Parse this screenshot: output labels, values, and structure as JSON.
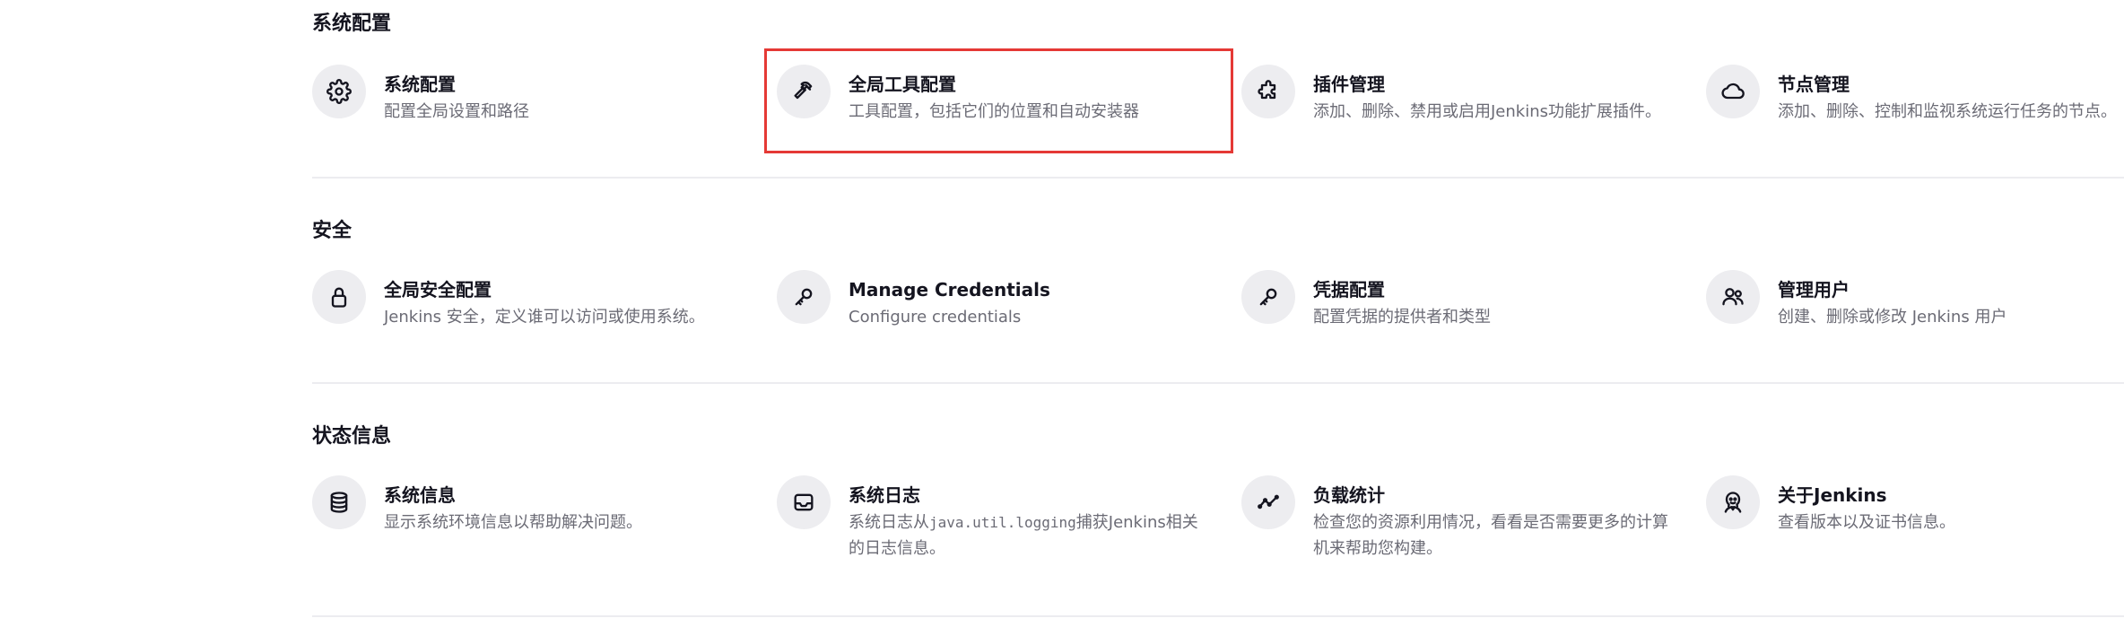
{
  "highlight_color": "#e53935",
  "sections": [
    {
      "title": "系统配置",
      "items": [
        {
          "title": "系统配置",
          "desc": "配置全局设置和路径",
          "icon": "gear-icon"
        },
        {
          "title": "全局工具配置",
          "desc": "工具配置，包括它们的位置和自动安装器",
          "icon": "hammer-icon"
        },
        {
          "title": "插件管理",
          "desc": "添加、删除、禁用或启用Jenkins功能扩展插件。",
          "icon": "puzzle-icon"
        },
        {
          "title": "节点管理",
          "desc": "添加、删除、控制和监视系统运行任务的节点。",
          "icon": "cloud-icon"
        }
      ]
    },
    {
      "title": "安全",
      "items": [
        {
          "title": "全局安全配置",
          "desc": "Jenkins 安全，定义谁可以访问或使用系统。",
          "icon": "lock-icon"
        },
        {
          "title": "Manage Credentials",
          "desc": "Configure credentials",
          "icon": "key-icon"
        },
        {
          "title": "凭据配置",
          "desc": "配置凭据的提供者和类型",
          "icon": "key-icon"
        },
        {
          "title": "管理用户",
          "desc": "创建、删除或修改 Jenkins 用户",
          "icon": "users-icon"
        }
      ]
    },
    {
      "title": "状态信息",
      "items": [
        {
          "title": "系统信息",
          "desc": "显示系统环境信息以帮助解决问题。",
          "icon": "database-icon"
        },
        {
          "title": "系统日志",
          "desc_pre": "系统日志从",
          "desc_code": "java.util.logging",
          "desc_post": "捕获Jenkins相关的日志信息。",
          "icon": "inbox-icon"
        },
        {
          "title": "负载统计",
          "desc": "检查您的资源利用情况，看看是否需要更多的计算机来帮助您构建。",
          "icon": "trend-icon"
        },
        {
          "title": "关于Jenkins",
          "desc": "查看版本以及证书信息。",
          "icon": "jenkins-icon"
        }
      ]
    }
  ]
}
